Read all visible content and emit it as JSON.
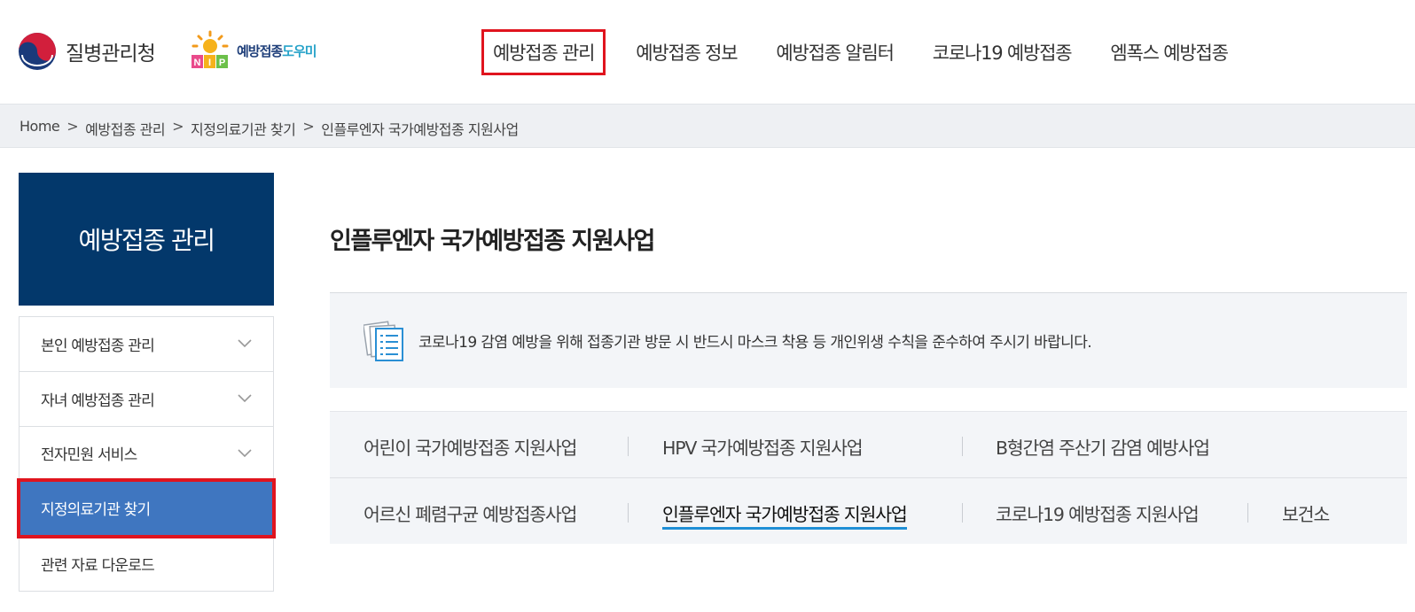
{
  "header": {
    "org_name": "질병관리청",
    "nip_logo_text_a": "예방접종",
    "nip_logo_text_b": "도우미",
    "nip_logo_mark_text": "NIP",
    "nav": [
      {
        "label": "예방접종 관리"
      },
      {
        "label": "예방접종 정보"
      },
      {
        "label": "예방접종 알림터"
      },
      {
        "label": "코로나19 예방접종"
      },
      {
        "label": "엠폭스 예방접종"
      }
    ]
  },
  "breadcrumb": {
    "items": [
      "Home",
      "예방접종 관리",
      "지정의료기관 찾기",
      "인플루엔자 국가예방접종 지원사업"
    ],
    "separator": ">"
  },
  "sidebar": {
    "title": "예방접종 관리",
    "items": [
      {
        "label": "본인 예방접종 관리",
        "icon": "chevron-down-icon"
      },
      {
        "label": "자녀 예방접종 관리",
        "icon": "chevron-down-icon"
      },
      {
        "label": "전자민원 서비스",
        "icon": "chevron-down-icon"
      },
      {
        "label": "지정의료기관 찾기"
      },
      {
        "label": "관련 자료 다운로드"
      }
    ]
  },
  "main": {
    "title": "인플루엔자 국가예방접종 지원사업",
    "notice": {
      "icon": "document-list-icon",
      "text": "코로나19 감염 예방을 위해 접종기관 방문 시 반드시 마스크 착용 등 개인위생 수칙을 준수하여 주시기 바랍니다."
    },
    "tabs_row1": [
      {
        "label": "어린이 국가예방접종 지원사업"
      },
      {
        "label": "HPV 국가예방접종 지원사업"
      },
      {
        "label": "B형간염 주산기 감염 예방사업"
      }
    ],
    "tabs_row2": [
      {
        "label": "어르신 폐렴구균 예방접종사업"
      },
      {
        "label": "인플루엔자 국가예방접종 지원사업"
      },
      {
        "label": "코로나19 예방접종 지원사업"
      },
      {
        "label": "보건소"
      }
    ]
  },
  "colors": {
    "sidebar_title_bg": "#03386b",
    "active_item_bg": "#3f76c0",
    "highlight_border": "#e0141e",
    "tab_underline": "#1f8fd6",
    "panel_bg": "#f3f5f8"
  }
}
